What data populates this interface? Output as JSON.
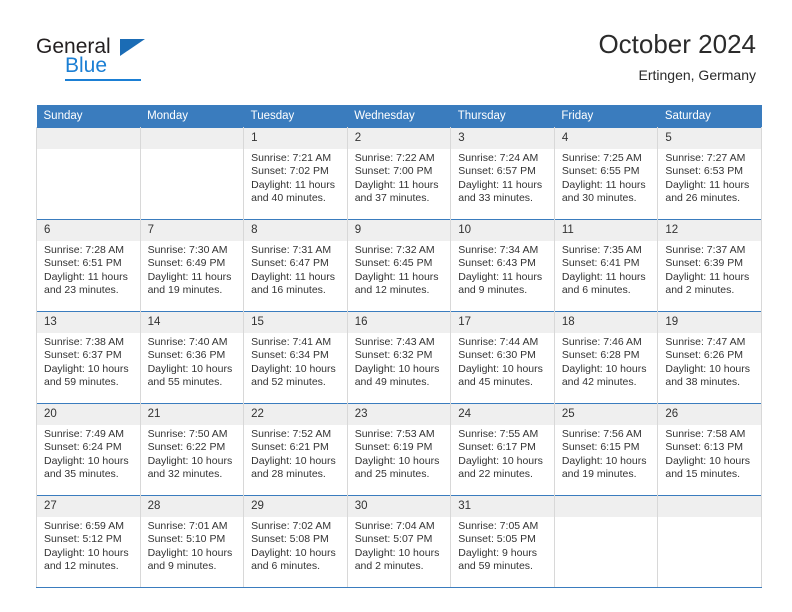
{
  "brand": {
    "name_part1": "General",
    "name_part2": "Blue",
    "triangle_color": "#1b6cb5",
    "blue_color": "#1b7fd4"
  },
  "header": {
    "title": "October 2024",
    "location": "Ertingen, Germany"
  },
  "colors": {
    "header_row_bg": "#3a7cbe",
    "header_row_text": "#ffffff",
    "daynum_bg": "#efefef",
    "cell_border": "#d8d8d8",
    "week_divider": "#3a7cbe",
    "text": "#333333"
  },
  "weekday_headers": [
    "Sunday",
    "Monday",
    "Tuesday",
    "Wednesday",
    "Thursday",
    "Friday",
    "Saturday"
  ],
  "labels": {
    "sunrise_prefix": "Sunrise:",
    "sunset_prefix": "Sunset:",
    "daylight_prefix": "Daylight:"
  },
  "weeks": [
    [
      {
        "day": "",
        "empty": true,
        "sunrise": "",
        "sunset": "",
        "daylight": ""
      },
      {
        "day": "",
        "empty": true,
        "sunrise": "",
        "sunset": "",
        "daylight": ""
      },
      {
        "day": "1",
        "empty": false,
        "sunrise": "Sunrise: 7:21 AM",
        "sunset": "Sunset: 7:02 PM",
        "daylight": "Daylight: 11 hours and 40 minutes."
      },
      {
        "day": "2",
        "empty": false,
        "sunrise": "Sunrise: 7:22 AM",
        "sunset": "Sunset: 7:00 PM",
        "daylight": "Daylight: 11 hours and 37 minutes."
      },
      {
        "day": "3",
        "empty": false,
        "sunrise": "Sunrise: 7:24 AM",
        "sunset": "Sunset: 6:57 PM",
        "daylight": "Daylight: 11 hours and 33 minutes."
      },
      {
        "day": "4",
        "empty": false,
        "sunrise": "Sunrise: 7:25 AM",
        "sunset": "Sunset: 6:55 PM",
        "daylight": "Daylight: 11 hours and 30 minutes."
      },
      {
        "day": "5",
        "empty": false,
        "sunrise": "Sunrise: 7:27 AM",
        "sunset": "Sunset: 6:53 PM",
        "daylight": "Daylight: 11 hours and 26 minutes."
      }
    ],
    [
      {
        "day": "6",
        "empty": false,
        "sunrise": "Sunrise: 7:28 AM",
        "sunset": "Sunset: 6:51 PM",
        "daylight": "Daylight: 11 hours and 23 minutes."
      },
      {
        "day": "7",
        "empty": false,
        "sunrise": "Sunrise: 7:30 AM",
        "sunset": "Sunset: 6:49 PM",
        "daylight": "Daylight: 11 hours and 19 minutes."
      },
      {
        "day": "8",
        "empty": false,
        "sunrise": "Sunrise: 7:31 AM",
        "sunset": "Sunset: 6:47 PM",
        "daylight": "Daylight: 11 hours and 16 minutes."
      },
      {
        "day": "9",
        "empty": false,
        "sunrise": "Sunrise: 7:32 AM",
        "sunset": "Sunset: 6:45 PM",
        "daylight": "Daylight: 11 hours and 12 minutes."
      },
      {
        "day": "10",
        "empty": false,
        "sunrise": "Sunrise: 7:34 AM",
        "sunset": "Sunset: 6:43 PM",
        "daylight": "Daylight: 11 hours and 9 minutes."
      },
      {
        "day": "11",
        "empty": false,
        "sunrise": "Sunrise: 7:35 AM",
        "sunset": "Sunset: 6:41 PM",
        "daylight": "Daylight: 11 hours and 6 minutes."
      },
      {
        "day": "12",
        "empty": false,
        "sunrise": "Sunrise: 7:37 AM",
        "sunset": "Sunset: 6:39 PM",
        "daylight": "Daylight: 11 hours and 2 minutes."
      }
    ],
    [
      {
        "day": "13",
        "empty": false,
        "sunrise": "Sunrise: 7:38 AM",
        "sunset": "Sunset: 6:37 PM",
        "daylight": "Daylight: 10 hours and 59 minutes."
      },
      {
        "day": "14",
        "empty": false,
        "sunrise": "Sunrise: 7:40 AM",
        "sunset": "Sunset: 6:36 PM",
        "daylight": "Daylight: 10 hours and 55 minutes."
      },
      {
        "day": "15",
        "empty": false,
        "sunrise": "Sunrise: 7:41 AM",
        "sunset": "Sunset: 6:34 PM",
        "daylight": "Daylight: 10 hours and 52 minutes."
      },
      {
        "day": "16",
        "empty": false,
        "sunrise": "Sunrise: 7:43 AM",
        "sunset": "Sunset: 6:32 PM",
        "daylight": "Daylight: 10 hours and 49 minutes."
      },
      {
        "day": "17",
        "empty": false,
        "sunrise": "Sunrise: 7:44 AM",
        "sunset": "Sunset: 6:30 PM",
        "daylight": "Daylight: 10 hours and 45 minutes."
      },
      {
        "day": "18",
        "empty": false,
        "sunrise": "Sunrise: 7:46 AM",
        "sunset": "Sunset: 6:28 PM",
        "daylight": "Daylight: 10 hours and 42 minutes."
      },
      {
        "day": "19",
        "empty": false,
        "sunrise": "Sunrise: 7:47 AM",
        "sunset": "Sunset: 6:26 PM",
        "daylight": "Daylight: 10 hours and 38 minutes."
      }
    ],
    [
      {
        "day": "20",
        "empty": false,
        "sunrise": "Sunrise: 7:49 AM",
        "sunset": "Sunset: 6:24 PM",
        "daylight": "Daylight: 10 hours and 35 minutes."
      },
      {
        "day": "21",
        "empty": false,
        "sunrise": "Sunrise: 7:50 AM",
        "sunset": "Sunset: 6:22 PM",
        "daylight": "Daylight: 10 hours and 32 minutes."
      },
      {
        "day": "22",
        "empty": false,
        "sunrise": "Sunrise: 7:52 AM",
        "sunset": "Sunset: 6:21 PM",
        "daylight": "Daylight: 10 hours and 28 minutes."
      },
      {
        "day": "23",
        "empty": false,
        "sunrise": "Sunrise: 7:53 AM",
        "sunset": "Sunset: 6:19 PM",
        "daylight": "Daylight: 10 hours and 25 minutes."
      },
      {
        "day": "24",
        "empty": false,
        "sunrise": "Sunrise: 7:55 AM",
        "sunset": "Sunset: 6:17 PM",
        "daylight": "Daylight: 10 hours and 22 minutes."
      },
      {
        "day": "25",
        "empty": false,
        "sunrise": "Sunrise: 7:56 AM",
        "sunset": "Sunset: 6:15 PM",
        "daylight": "Daylight: 10 hours and 19 minutes."
      },
      {
        "day": "26",
        "empty": false,
        "sunrise": "Sunrise: 7:58 AM",
        "sunset": "Sunset: 6:13 PM",
        "daylight": "Daylight: 10 hours and 15 minutes."
      }
    ],
    [
      {
        "day": "27",
        "empty": false,
        "sunrise": "Sunrise: 6:59 AM",
        "sunset": "Sunset: 5:12 PM",
        "daylight": "Daylight: 10 hours and 12 minutes."
      },
      {
        "day": "28",
        "empty": false,
        "sunrise": "Sunrise: 7:01 AM",
        "sunset": "Sunset: 5:10 PM",
        "daylight": "Daylight: 10 hours and 9 minutes."
      },
      {
        "day": "29",
        "empty": false,
        "sunrise": "Sunrise: 7:02 AM",
        "sunset": "Sunset: 5:08 PM",
        "daylight": "Daylight: 10 hours and 6 minutes."
      },
      {
        "day": "30",
        "empty": false,
        "sunrise": "Sunrise: 7:04 AM",
        "sunset": "Sunset: 5:07 PM",
        "daylight": "Daylight: 10 hours and 2 minutes."
      },
      {
        "day": "31",
        "empty": false,
        "sunrise": "Sunrise: 7:05 AM",
        "sunset": "Sunset: 5:05 PM",
        "daylight": "Daylight: 9 hours and 59 minutes."
      },
      {
        "day": "",
        "empty": true,
        "sunrise": "",
        "sunset": "",
        "daylight": ""
      },
      {
        "day": "",
        "empty": true,
        "sunrise": "",
        "sunset": "",
        "daylight": ""
      }
    ]
  ]
}
